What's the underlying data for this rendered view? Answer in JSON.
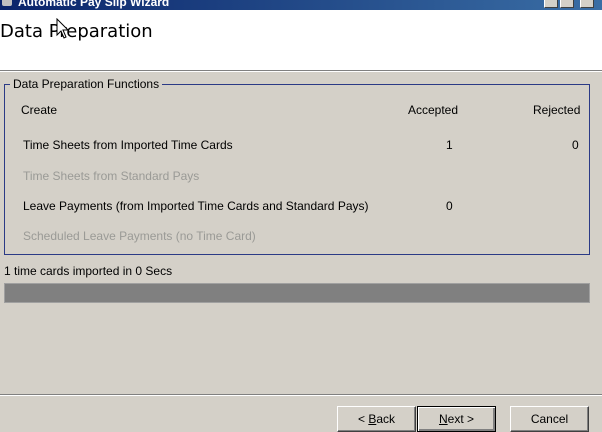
{
  "window": {
    "title": "Automatic Pay Slip Wizard"
  },
  "header": {
    "title": "Data Preparation"
  },
  "group": {
    "legend": "Data Preparation Functions",
    "columns": {
      "create": "Create",
      "accepted": "Accepted",
      "rejected": "Rejected"
    },
    "rows": [
      {
        "label": "Time Sheets from Imported Time Cards",
        "accepted": "1",
        "rejected": "0",
        "enabled": true
      },
      {
        "label": "Time Sheets from Standard Pays",
        "accepted": "",
        "rejected": "",
        "enabled": false
      },
      {
        "label": "Leave Payments (from Imported Time Cards and Standard Pays)",
        "accepted": "0",
        "rejected": "",
        "enabled": true
      },
      {
        "label": "Scheduled Leave Payments (no Time Card)",
        "accepted": "",
        "rejected": "",
        "enabled": false
      }
    ]
  },
  "status": {
    "text": "1 time cards imported in 0 Secs",
    "progress": 1.0
  },
  "buttons": {
    "back": "< Back",
    "next": "Next >",
    "cancel": "Cancel"
  },
  "colors": {
    "groupbox_border": "#2b3a86",
    "progress_fill": "#808080",
    "disabled_text": "#9a9a96"
  }
}
